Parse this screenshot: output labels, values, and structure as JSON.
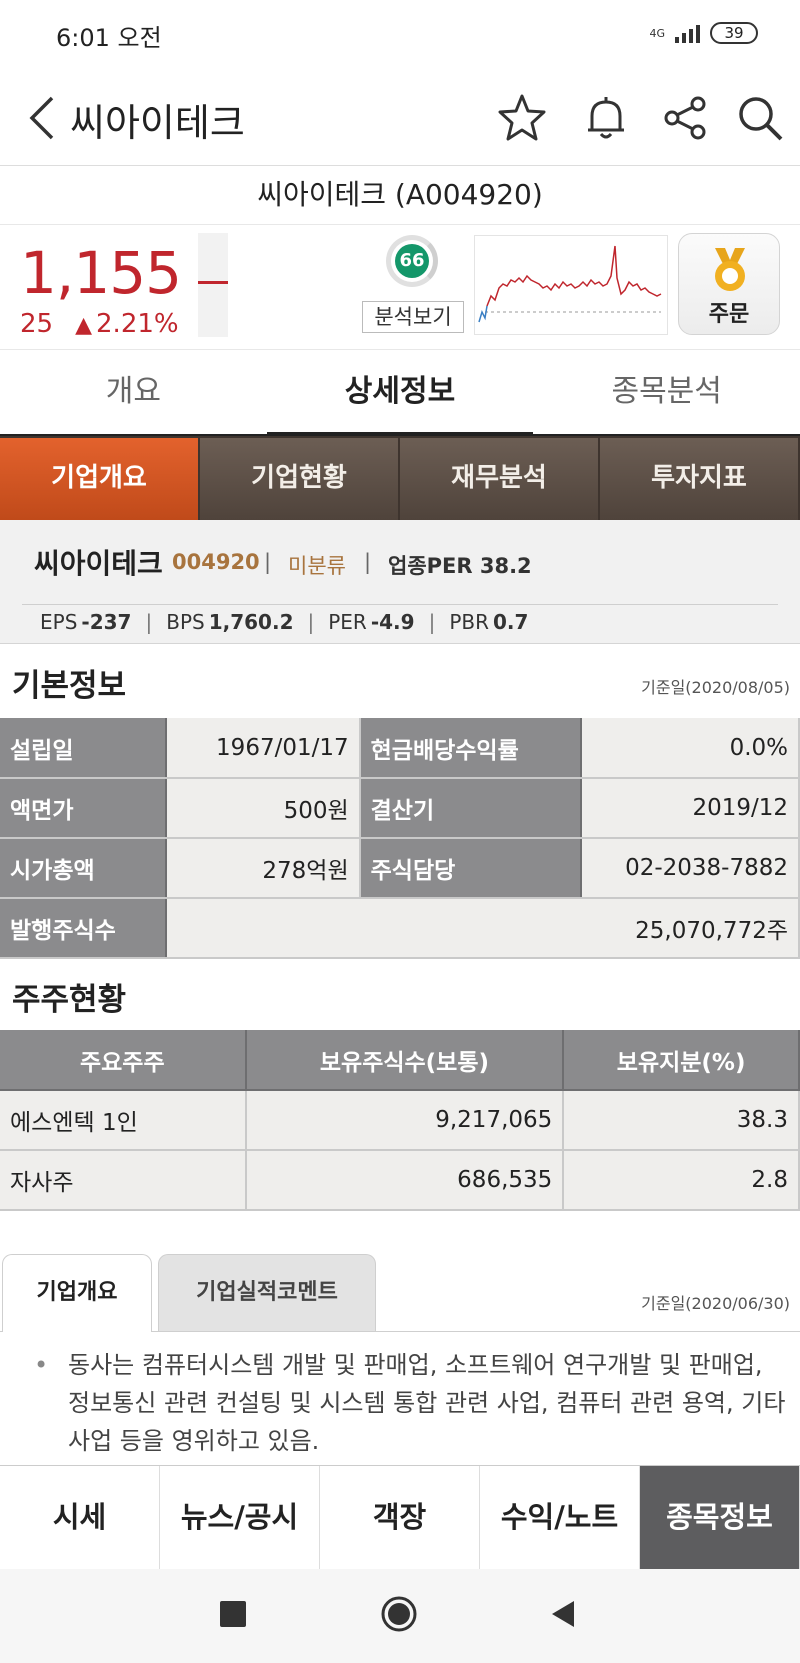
{
  "status_bar": {
    "time": "6:01 오전",
    "network": "4G",
    "battery": "39"
  },
  "header": {
    "title": "씨아이테크",
    "icons": [
      "back-icon",
      "star-icon",
      "bell-icon",
      "share-icon",
      "search-icon"
    ]
  },
  "stock": {
    "full_name": "씨아이테크 (A004920)",
    "price": "1,155",
    "change": "25",
    "change_pct": "2.21%",
    "score": "66",
    "analysis_button": "분석보기",
    "order_button": "주문"
  },
  "main_tabs": [
    {
      "label": "개요",
      "active": false
    },
    {
      "label": "상세정보",
      "active": true
    },
    {
      "label": "종목분석",
      "active": false
    }
  ],
  "sub_tabs": [
    {
      "label": "기업개요",
      "active": true
    },
    {
      "label": "기업현황",
      "active": false
    },
    {
      "label": "재무분석",
      "active": false
    },
    {
      "label": "투자지표",
      "active": false
    }
  ],
  "summary": {
    "name": "씨아이테크",
    "code": "004920",
    "sep": "|",
    "classification": "미분류",
    "sector_per": "업종PER 38.2",
    "metrics": [
      {
        "label": "EPS",
        "value": "-237"
      },
      {
        "label": "BPS",
        "value": "1,760.2"
      },
      {
        "label": "PER",
        "value": "-4.9"
      },
      {
        "label": "PBR",
        "value": "0.7"
      }
    ]
  },
  "basic_info": {
    "title": "기본정보",
    "date": "기준일(2020/08/05)",
    "rows": [
      {
        "k1": "설립일",
        "v1": "1967/01/17",
        "k2": "현금배당수익률",
        "v2": "0.0%"
      },
      {
        "k1": "액면가",
        "v1": "500원",
        "k2": "결산기",
        "v2": "2019/12"
      },
      {
        "k1": "시가총액",
        "v1": "278억원",
        "k2": "주식담당",
        "v2": "02-2038-7882"
      }
    ],
    "shares_label": "발행주식수",
    "shares_value": "25,070,772주"
  },
  "shareholders": {
    "title": "주주현황",
    "headers": [
      "주요주주",
      "보유주식수(보통)",
      "보유지분(%)"
    ],
    "rows": [
      [
        "에스엔텍 1인",
        "9,217,065",
        "38.3"
      ],
      [
        "자사주",
        "686,535",
        "2.8"
      ]
    ]
  },
  "company": {
    "tabs": [
      {
        "label": "기업개요",
        "active": true
      },
      {
        "label": "기업실적코멘트",
        "active": false
      }
    ],
    "date": "기준일(2020/06/30)",
    "bullet": "•",
    "description": "동사는 컴퓨터시스템 개발 및 판매업, 소프트웨어 연구개발 및 판매업, 정보통신 관련 컨설팅 및 시스템 통합 관련 사업, 컴퓨터 관련 용역, 기타 사업 등을 영위하고 있음."
  },
  "bottom_nav": [
    {
      "label": "시세",
      "active": false
    },
    {
      "label": "뉴스/공시",
      "active": false
    },
    {
      "label": "객장",
      "active": false
    },
    {
      "label": "수익/노트",
      "active": false
    },
    {
      "label": "종목정보",
      "active": true
    }
  ],
  "colors": {
    "price_red": "#c0262d",
    "tab_brown": "#5a4d44",
    "tab_orange": "#d9582a",
    "table_header_gray": "#8b8b8d",
    "score_green": "#14976a"
  }
}
